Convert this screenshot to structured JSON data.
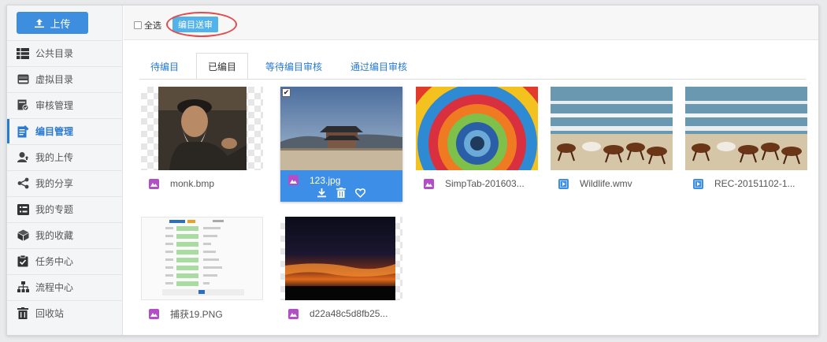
{
  "sidebar": {
    "upload_label": "上传",
    "items": [
      {
        "label": "公共目录",
        "icon": "grid-list-icon"
      },
      {
        "label": "虚拟目录",
        "icon": "drive-icon"
      },
      {
        "label": "审核管理",
        "icon": "audit-icon"
      },
      {
        "label": "编目管理",
        "icon": "catalog-edit-icon",
        "active": true
      },
      {
        "label": "我的上传",
        "icon": "user-upload-icon"
      },
      {
        "label": "我的分享",
        "icon": "share-icon"
      },
      {
        "label": "我的专题",
        "icon": "topic-list-icon"
      },
      {
        "label": "我的收藏",
        "icon": "favorite-box-icon"
      },
      {
        "label": "任务中心",
        "icon": "task-clipboard-icon"
      },
      {
        "label": "流程中心",
        "icon": "workflow-icon"
      },
      {
        "label": "回收站",
        "icon": "trash-icon"
      }
    ]
  },
  "toolbar": {
    "select_all_label": "全选",
    "batch_button_label": "编目送审"
  },
  "tabs": [
    "待编目",
    "已编目",
    "等待编目审核",
    "通过编目审核"
  ],
  "active_tab": "已编目",
  "files": [
    {
      "name": "monk.bmp",
      "type": "image",
      "selected": false
    },
    {
      "name": "123.jpg",
      "type": "image",
      "selected": true
    },
    {
      "name": "SimpTab-201603...",
      "type": "image",
      "selected": false
    },
    {
      "name": "Wildlife.wmv",
      "type": "video",
      "selected": false
    },
    {
      "name": "REC-20151102-1...",
      "type": "video",
      "selected": false
    },
    {
      "name": "捕获19.PNG",
      "type": "image",
      "selected": false
    },
    {
      "name": "d22a48c5d8fb25...",
      "type": "image",
      "selected": false
    }
  ],
  "colors": {
    "accent": "#3e8ee0",
    "highlight_ring": "#e04b4b",
    "image_icon": "#b24fc7",
    "video_icon": "#3d8ee6"
  }
}
